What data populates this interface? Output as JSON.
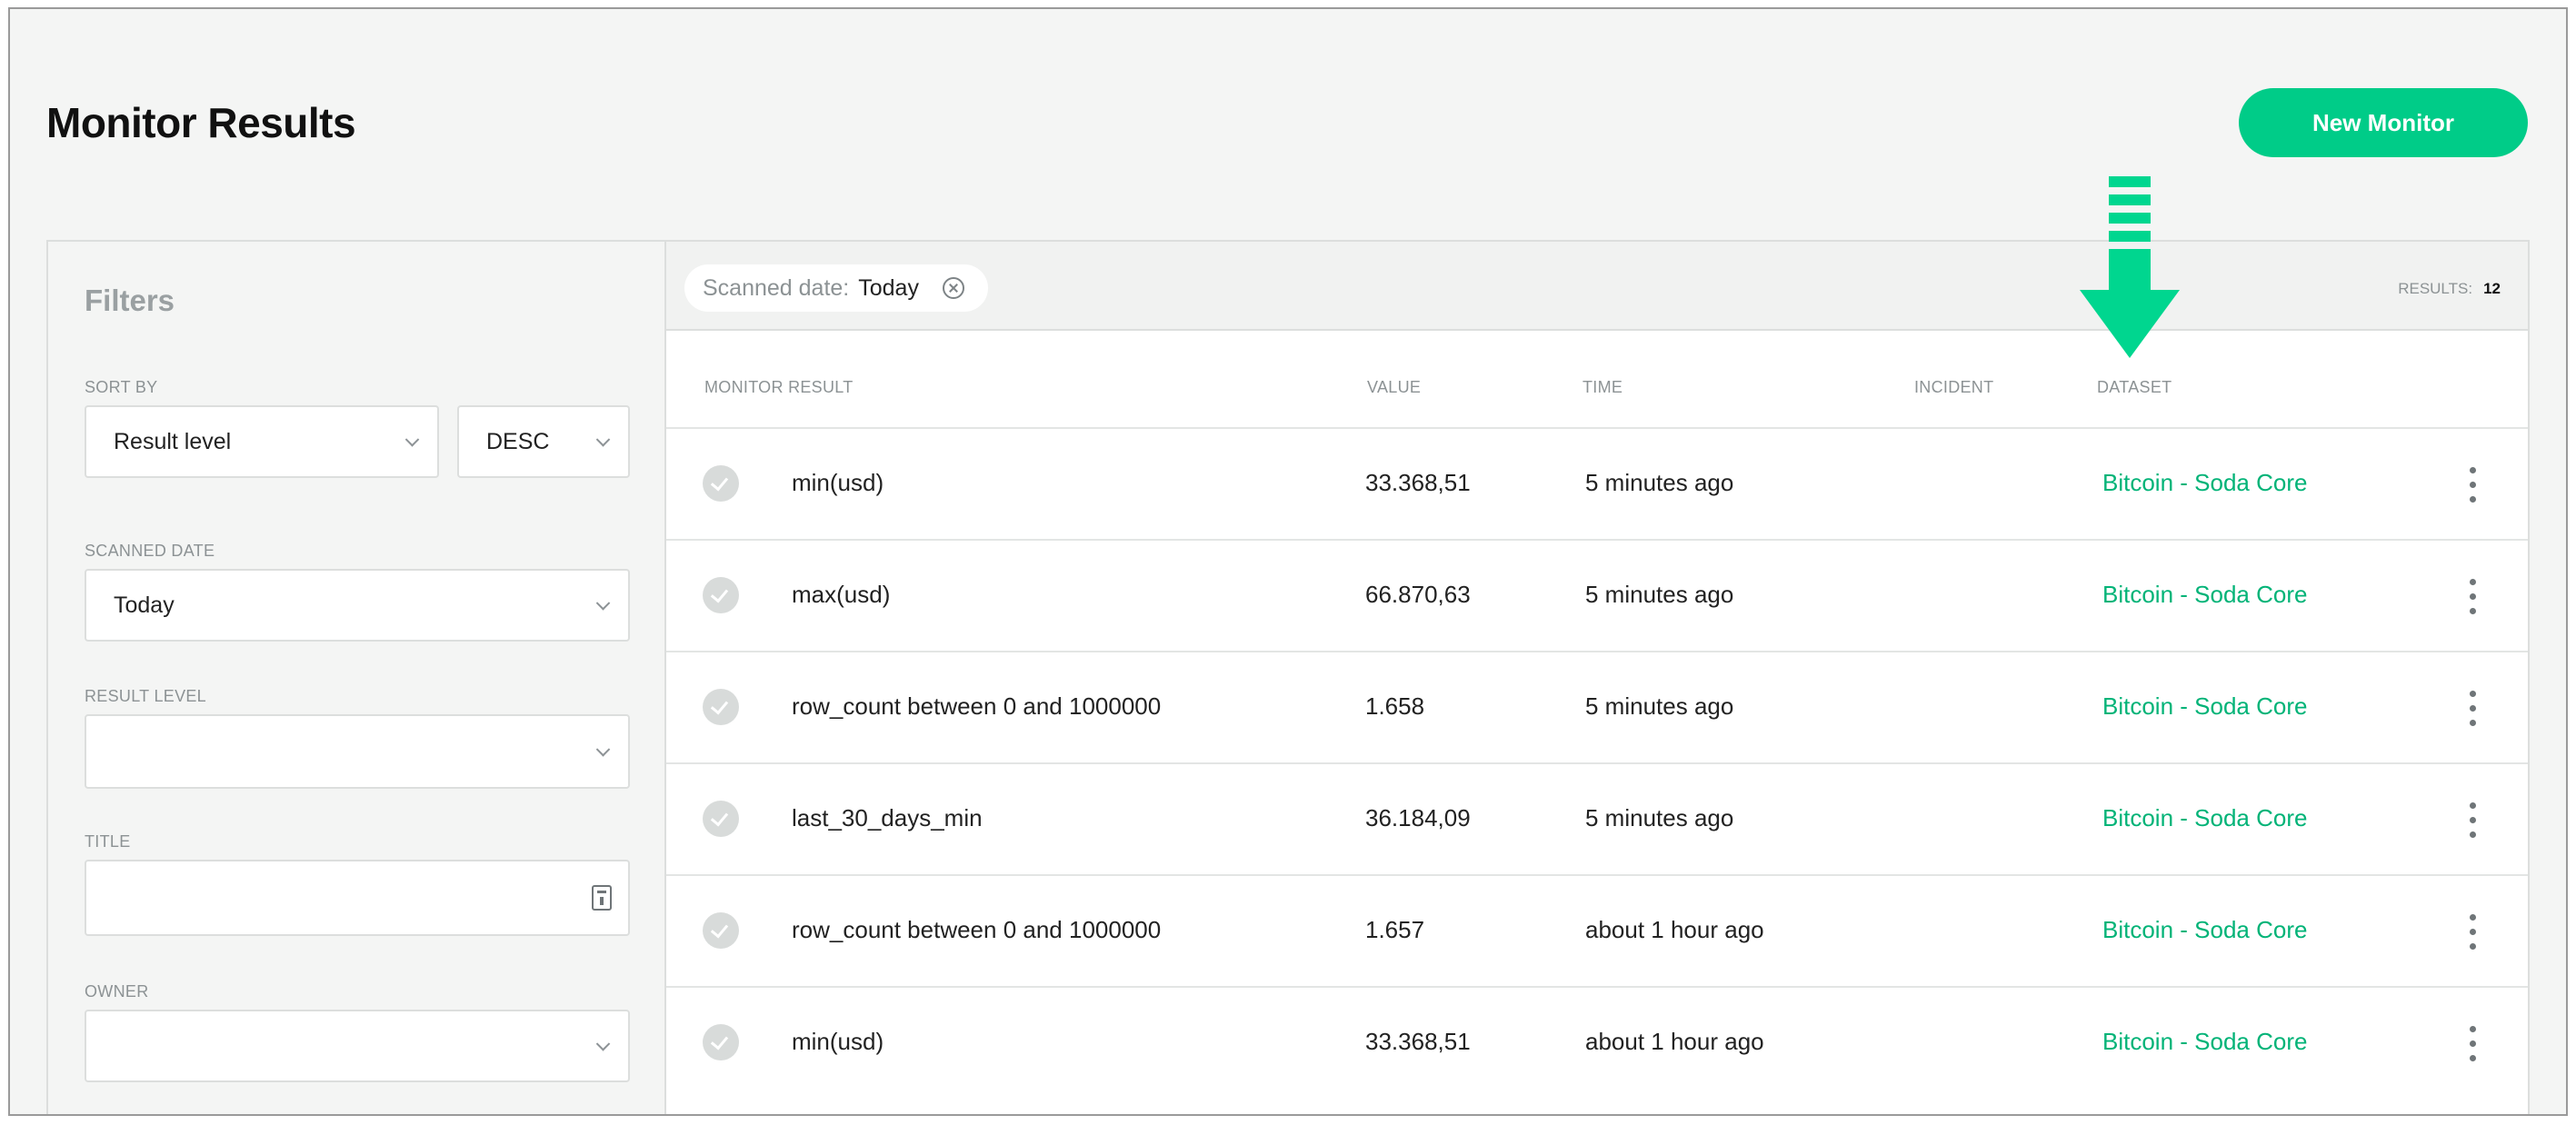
{
  "page": {
    "title": "Monitor Results"
  },
  "actions": {
    "new_monitor_label": "New Monitor"
  },
  "filters": {
    "title": "Filters",
    "sort_by_label": "SORT BY",
    "sort_field": "Result level",
    "sort_order": "DESC",
    "scanned_date_label": "SCANNED DATE",
    "scanned_date_value": "Today",
    "result_level_label": "RESULT LEVEL",
    "result_level_value": "",
    "title_label": "TITLE",
    "title_value": "",
    "owner_label": "OWNER",
    "owner_value": ""
  },
  "active_filter": {
    "key": "Scanned date:",
    "value": "Today"
  },
  "results_summary": {
    "label": "RESULTS:",
    "count": "12"
  },
  "table": {
    "columns": [
      "MONITOR RESULT",
      "VALUE",
      "TIME",
      "INCIDENT",
      "DATASET"
    ],
    "rows": [
      {
        "result": "min(usd)",
        "value": "33.368,51",
        "time": "5 minutes ago",
        "incident": "",
        "dataset": "Bitcoin - Soda Core",
        "status": "passed"
      },
      {
        "result": "max(usd)",
        "value": "66.870,63",
        "time": "5 minutes ago",
        "incident": "",
        "dataset": "Bitcoin - Soda Core",
        "status": "passed"
      },
      {
        "result": "row_count between 0 and 1000000",
        "value": "1.658",
        "time": "5 minutes ago",
        "incident": "",
        "dataset": "Bitcoin - Soda Core",
        "status": "passed"
      },
      {
        "result": "last_30_days_min",
        "value": "36.184,09",
        "time": "5 minutes ago",
        "incident": "",
        "dataset": "Bitcoin - Soda Core",
        "status": "passed"
      },
      {
        "result": "row_count between 0 and 1000000",
        "value": "1.657",
        "time": "about 1 hour ago",
        "incident": "",
        "dataset": "Bitcoin - Soda Core",
        "status": "passed"
      },
      {
        "result": "min(usd)",
        "value": "33.368,51",
        "time": "about 1 hour ago",
        "incident": "",
        "dataset": "Bitcoin - Soda Core",
        "status": "passed"
      }
    ]
  },
  "colors": {
    "accent": "#00cc88",
    "dataset_link": "#00b377",
    "annotation_arrow": "#00d68f"
  },
  "icons": {
    "status": "check-circle-icon",
    "menu": "kebab-menu-icon",
    "clear_filter": "close-circle-icon",
    "calendar": "calendar-icon",
    "annotation": "down-arrow-annotation"
  }
}
